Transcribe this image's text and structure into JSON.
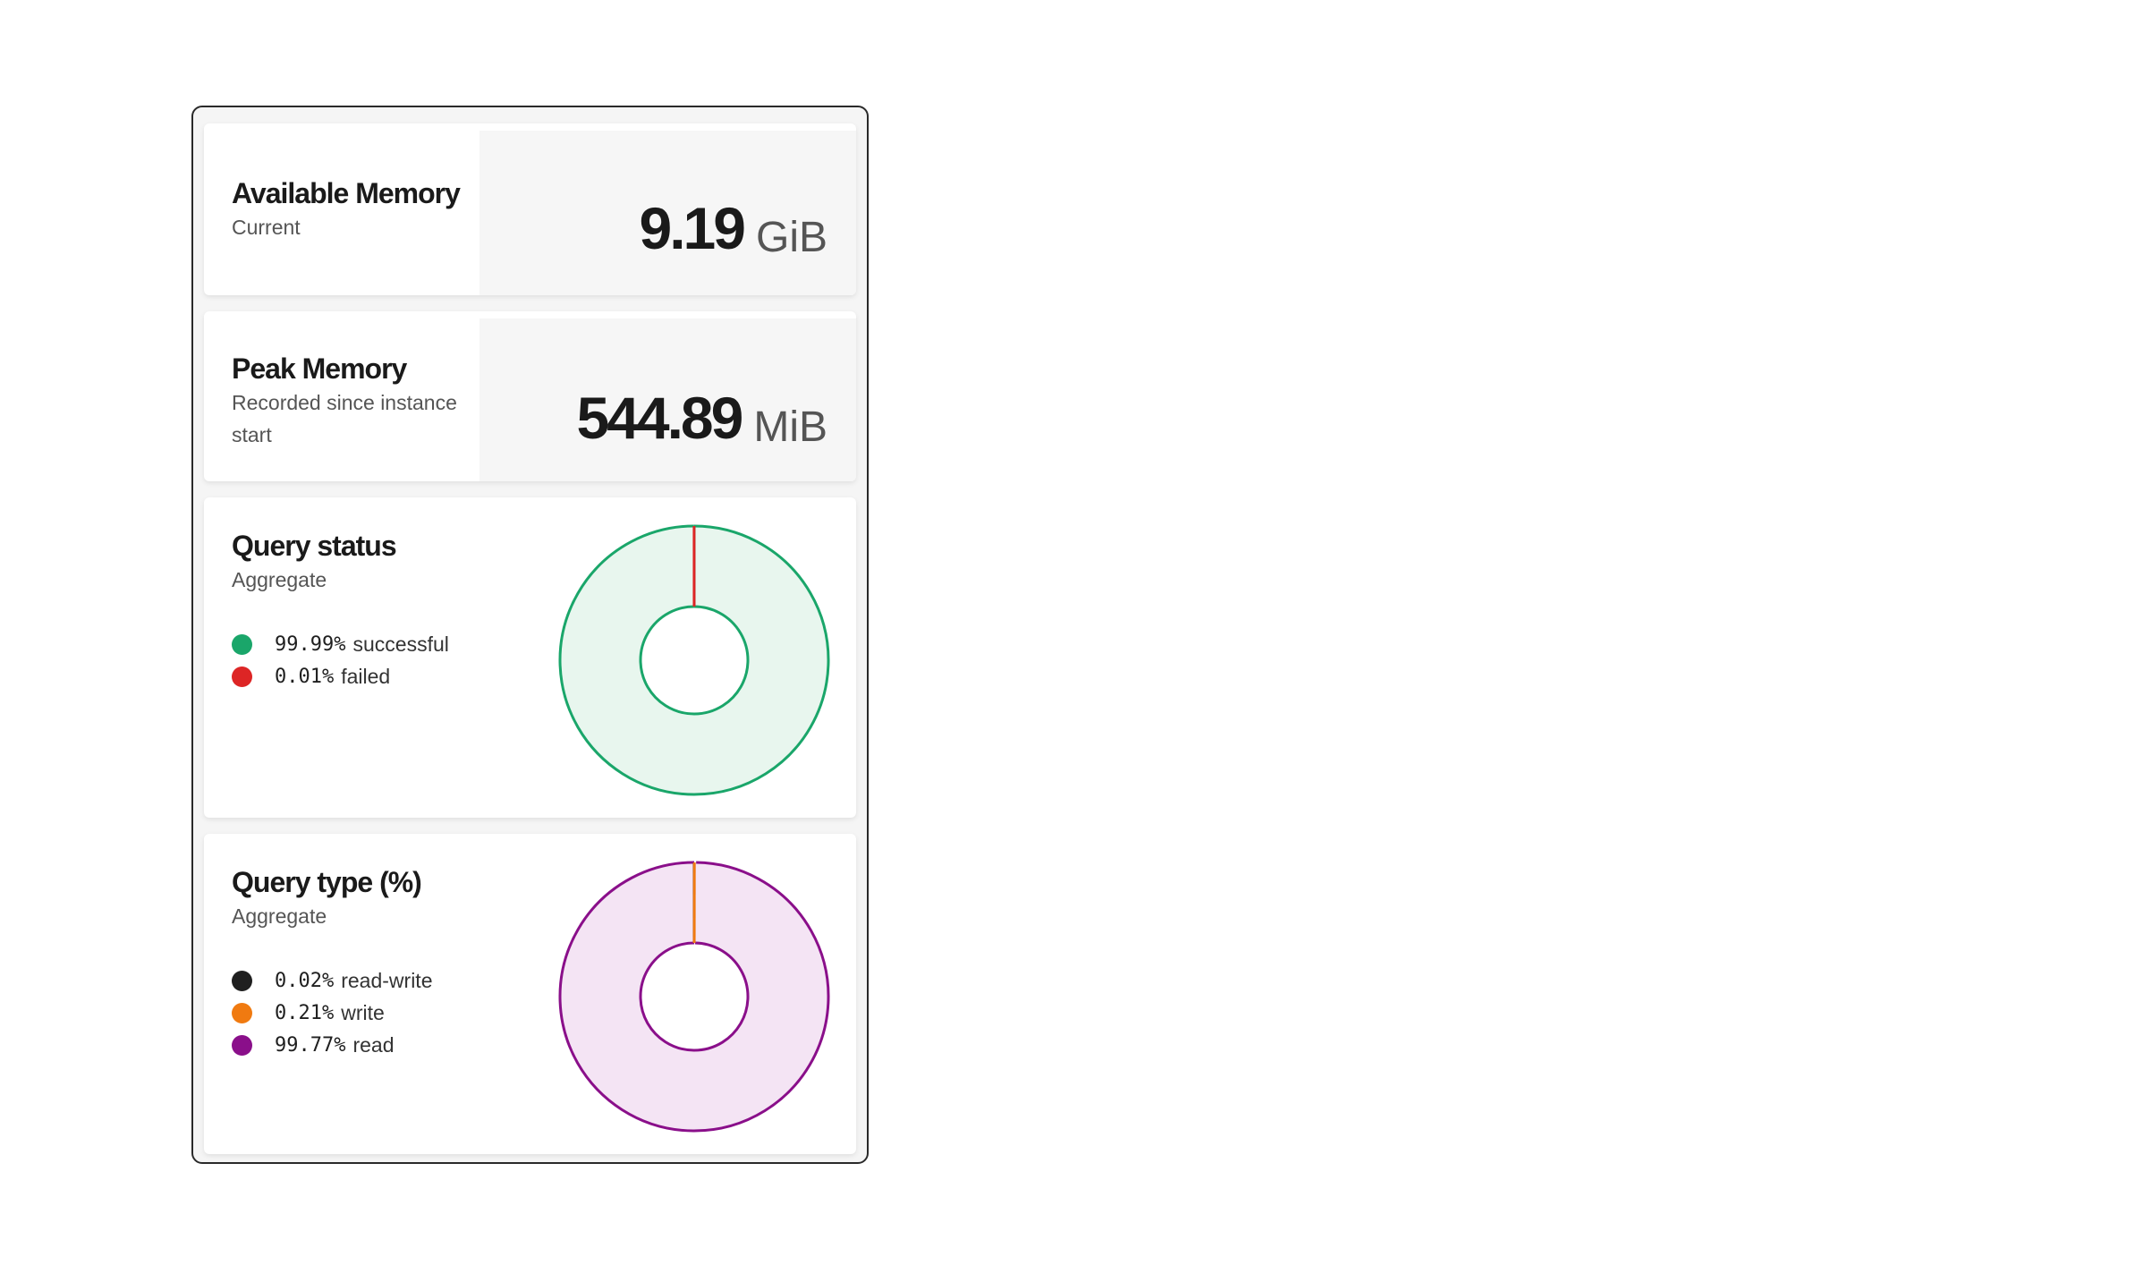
{
  "available_memory": {
    "title": "Available Memory",
    "subtitle": "Current",
    "value": "9.19",
    "unit": "GiB"
  },
  "peak_memory": {
    "title": "Peak Memory",
    "subtitle": "Recorded since instance start",
    "value": "544.89",
    "unit": "MiB"
  },
  "query_status": {
    "title": "Query status",
    "subtitle": "Aggregate",
    "legend": [
      {
        "pct": "99.99%",
        "label": "successful",
        "color": "#1aa66a"
      },
      {
        "pct": "0.01%",
        "label": "failed",
        "color": "#dd2525"
      }
    ]
  },
  "query_type": {
    "title": "Query type (%)",
    "subtitle": "Aggregate",
    "legend": [
      {
        "pct": "0.02%",
        "label": "read-write",
        "color": "#1f1f1f"
      },
      {
        "pct": "0.21%",
        "label": "write",
        "color": "#f07a10"
      },
      {
        "pct": "99.77%",
        "label": "read",
        "color": "#8a0f8a"
      }
    ]
  },
  "chart_data": [
    {
      "type": "pie",
      "categories": [
        "successful",
        "failed"
      ],
      "values": [
        99.99,
        0.01
      ],
      "colors": [
        "#1aa66a",
        "#dd2525"
      ],
      "fill": "#e8f6ee"
    },
    {
      "type": "pie",
      "categories": [
        "read-write",
        "write",
        "read"
      ],
      "values": [
        0.02,
        0.21,
        99.77
      ],
      "colors": [
        "#1f1f1f",
        "#f07a10",
        "#8a0f8a"
      ],
      "fill": "#f4e4f4"
    }
  ]
}
